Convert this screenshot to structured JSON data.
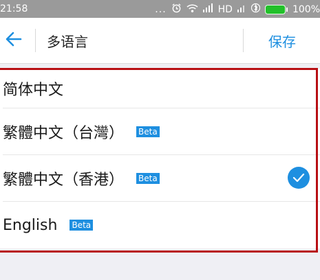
{
  "status_bar": {
    "time": "21:58",
    "dots": "...",
    "network": "HD",
    "battery": "100%",
    "icons": [
      "alarm-icon",
      "wifi-icon",
      "signal-icon",
      "signal-icon",
      "bluetooth-icon",
      "battery-icon"
    ]
  },
  "header": {
    "back_icon": "arrow-left-icon",
    "title": "多语言",
    "save_label": "保存"
  },
  "languages": [
    {
      "label": "简体中文",
      "badge": "",
      "selected": false
    },
    {
      "label": "繁體中文（台灣）",
      "badge": "Beta",
      "selected": false
    },
    {
      "label": "繁體中文（香港）",
      "badge": "Beta",
      "selected": true
    },
    {
      "label": "English",
      "badge": "Beta",
      "selected": false
    }
  ],
  "colors": {
    "accent": "#1e8fe0",
    "highlight_frame": "#b80f14",
    "status_bar": "#9a9a9a",
    "battery": "#22c02a"
  }
}
